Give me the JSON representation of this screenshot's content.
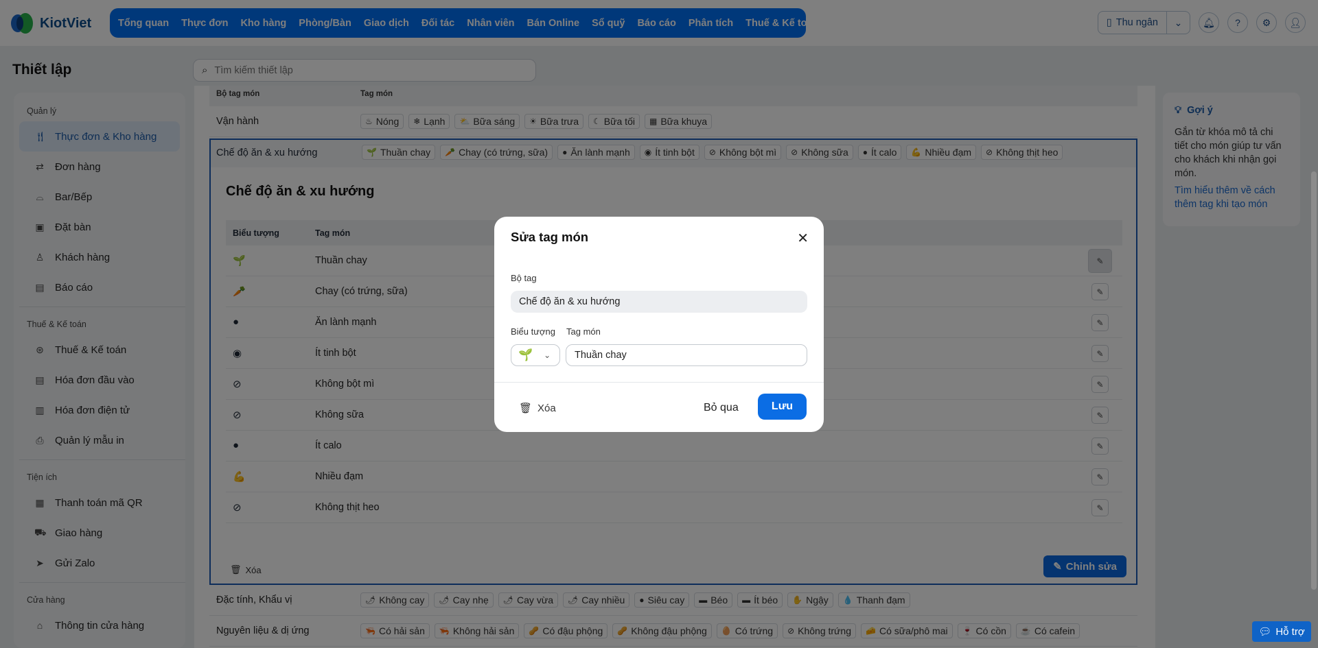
{
  "header": {
    "brand": "KiotViet",
    "nav": [
      "Tổng quan",
      "Thực đơn",
      "Kho hàng",
      "Phòng/Bàn",
      "Giao dịch",
      "Đối tác",
      "Nhân viên",
      "Bán Online",
      "Sổ quỹ",
      "Báo cáo",
      "Phân tích",
      "Thuế & Kế toán"
    ],
    "cashier_label": "Thu ngân"
  },
  "page": {
    "title": "Thiết lập",
    "search_placeholder": "Tìm kiếm thiết lập"
  },
  "sidebar": {
    "sections": [
      {
        "title": "Quản lý",
        "items": [
          {
            "label": "Thực đơn & Kho hàng",
            "icon": "utensils-icon"
          },
          {
            "label": "Đơn hàng",
            "icon": "swap-icon"
          },
          {
            "label": "Bar/Bếp",
            "icon": "cloche-icon"
          },
          {
            "label": "Đặt bàn",
            "icon": "calendar-icon"
          },
          {
            "label": "Khách hàng",
            "icon": "user-icon"
          },
          {
            "label": "Báo cáo",
            "icon": "report-icon"
          }
        ]
      },
      {
        "title": "Thuế & Kế toán",
        "items": [
          {
            "label": "Thuế & Kế toán",
            "icon": "tax-icon"
          },
          {
            "label": "Hóa đơn đầu vào",
            "icon": "invoice-icon"
          },
          {
            "label": "Hóa đơn điện tử",
            "icon": "e-invoice-icon"
          },
          {
            "label": "Quản lý mẫu in",
            "icon": "printer-icon"
          }
        ]
      },
      {
        "title": "Tiện ích",
        "items": [
          {
            "label": "Thanh toán mã QR",
            "icon": "qr-icon"
          },
          {
            "label": "Giao hàng",
            "icon": "truck-icon"
          },
          {
            "label": "Gửi Zalo",
            "icon": "send-icon"
          }
        ]
      },
      {
        "title": "Cửa hàng",
        "items": [
          {
            "label": "Thông tin cửa hàng",
            "icon": "store-icon"
          }
        ]
      }
    ]
  },
  "table": {
    "headers": [
      "Bộ tag món",
      "Tag món"
    ],
    "rows_top": [
      {
        "name": "Vận hành",
        "tags": [
          {
            "e": "♨",
            "t": "Nóng"
          },
          {
            "e": "❄",
            "t": "Lạnh"
          },
          {
            "e": "⛅",
            "t": "Bữa sáng"
          },
          {
            "e": "☀",
            "t": "Bữa trưa"
          },
          {
            "e": "☾",
            "t": "Bữa tối"
          },
          {
            "e": "▦",
            "t": "Bữa khuya"
          }
        ]
      }
    ],
    "expanded": {
      "name": "Chế độ ăn & xu hướng",
      "tags": [
        {
          "e": "🌱",
          "t": "Thuần chay"
        },
        {
          "e": "🥕",
          "t": "Chay (có trứng, sữa)"
        },
        {
          "e": "●",
          "t": "Ăn lành mạnh"
        },
        {
          "e": "◉",
          "t": "Ít tinh bột"
        },
        {
          "e": "⊘",
          "t": "Không bột mì"
        },
        {
          "e": "⊘",
          "t": "Không sữa"
        },
        {
          "e": "●",
          "t": "Ít calo"
        },
        {
          "e": "💪",
          "t": "Nhiều đạm"
        },
        {
          "e": "⊘",
          "t": "Không thịt heo"
        }
      ],
      "title": "Chế độ ăn & xu hướng",
      "headers": [
        "Biểu tượng",
        "Tag món"
      ],
      "items": [
        {
          "e": "🌱",
          "t": "Thuần chay"
        },
        {
          "e": "🥕",
          "t": "Chay (có trứng, sữa)"
        },
        {
          "e": "●",
          "t": "Ăn lành mạnh"
        },
        {
          "e": "◉",
          "t": "Ít tinh bột"
        },
        {
          "e": "⊘",
          "t": "Không bột mì"
        },
        {
          "e": "⊘",
          "t": "Không sữa"
        },
        {
          "e": "●",
          "t": "Ít calo"
        },
        {
          "e": "💪",
          "t": "Nhiều đạm"
        },
        {
          "e": "⊘",
          "t": "Không thịt heo"
        }
      ],
      "delete_label": "Xóa",
      "edit_label": "Chỉnh sửa"
    },
    "rows_bottom": [
      {
        "name": "Đặc tính, Khẩu vị",
        "tags": [
          {
            "e": "🌶",
            "t": "Không cay"
          },
          {
            "e": "🌶",
            "t": "Cay nhẹ"
          },
          {
            "e": "🌶",
            "t": "Cay vừa"
          },
          {
            "e": "🌶",
            "t": "Cay nhiều"
          },
          {
            "e": "●",
            "t": "Siêu cay"
          },
          {
            "e": "▬",
            "t": "Béo"
          },
          {
            "e": "▬",
            "t": "Ít béo"
          },
          {
            "e": "✋",
            "t": "Ngậy"
          },
          {
            "e": "💧",
            "t": "Thanh đạm"
          }
        ]
      },
      {
        "name": "Nguyên liệu & dị ứng",
        "tags": [
          {
            "e": "🦐",
            "t": "Có hải sản"
          },
          {
            "e": "🦐",
            "t": "Không hải sản"
          },
          {
            "e": "🥜",
            "t": "Có đậu phộng"
          },
          {
            "e": "🥜",
            "t": "Không đậu phộng"
          },
          {
            "e": "🥚",
            "t": "Có trứng"
          },
          {
            "e": "⊘",
            "t": "Không trứng"
          },
          {
            "e": "🧀",
            "t": "Có sữa/phô mai"
          },
          {
            "e": "🍷",
            "t": "Có cồn"
          },
          {
            "e": "☕",
            "t": "Có cafein"
          }
        ]
      }
    ]
  },
  "hint": {
    "title": "Gợi ý",
    "text": "Gắn từ khóa mô tả chi tiết cho món giúp tư vấn cho khách khi nhận gọi món.",
    "link": "Tìm hiểu thêm về cách thêm tag khi tạo món"
  },
  "modal": {
    "title": "Sửa tag món",
    "group_label": "Bộ tag",
    "group_value": "Chế độ ăn & xu hướng",
    "icon_label": "Biểu tượng",
    "tag_label": "Tag món",
    "tag_value": "Thuần chay",
    "icon_value": "🌱",
    "delete_label": "Xóa",
    "cancel_label": "Bỏ qua",
    "save_label": "Lưu"
  },
  "support_label": "Hỗ trợ",
  "colors": {
    "primary": "#0070f4",
    "accent_border": "#1a5bb5"
  }
}
